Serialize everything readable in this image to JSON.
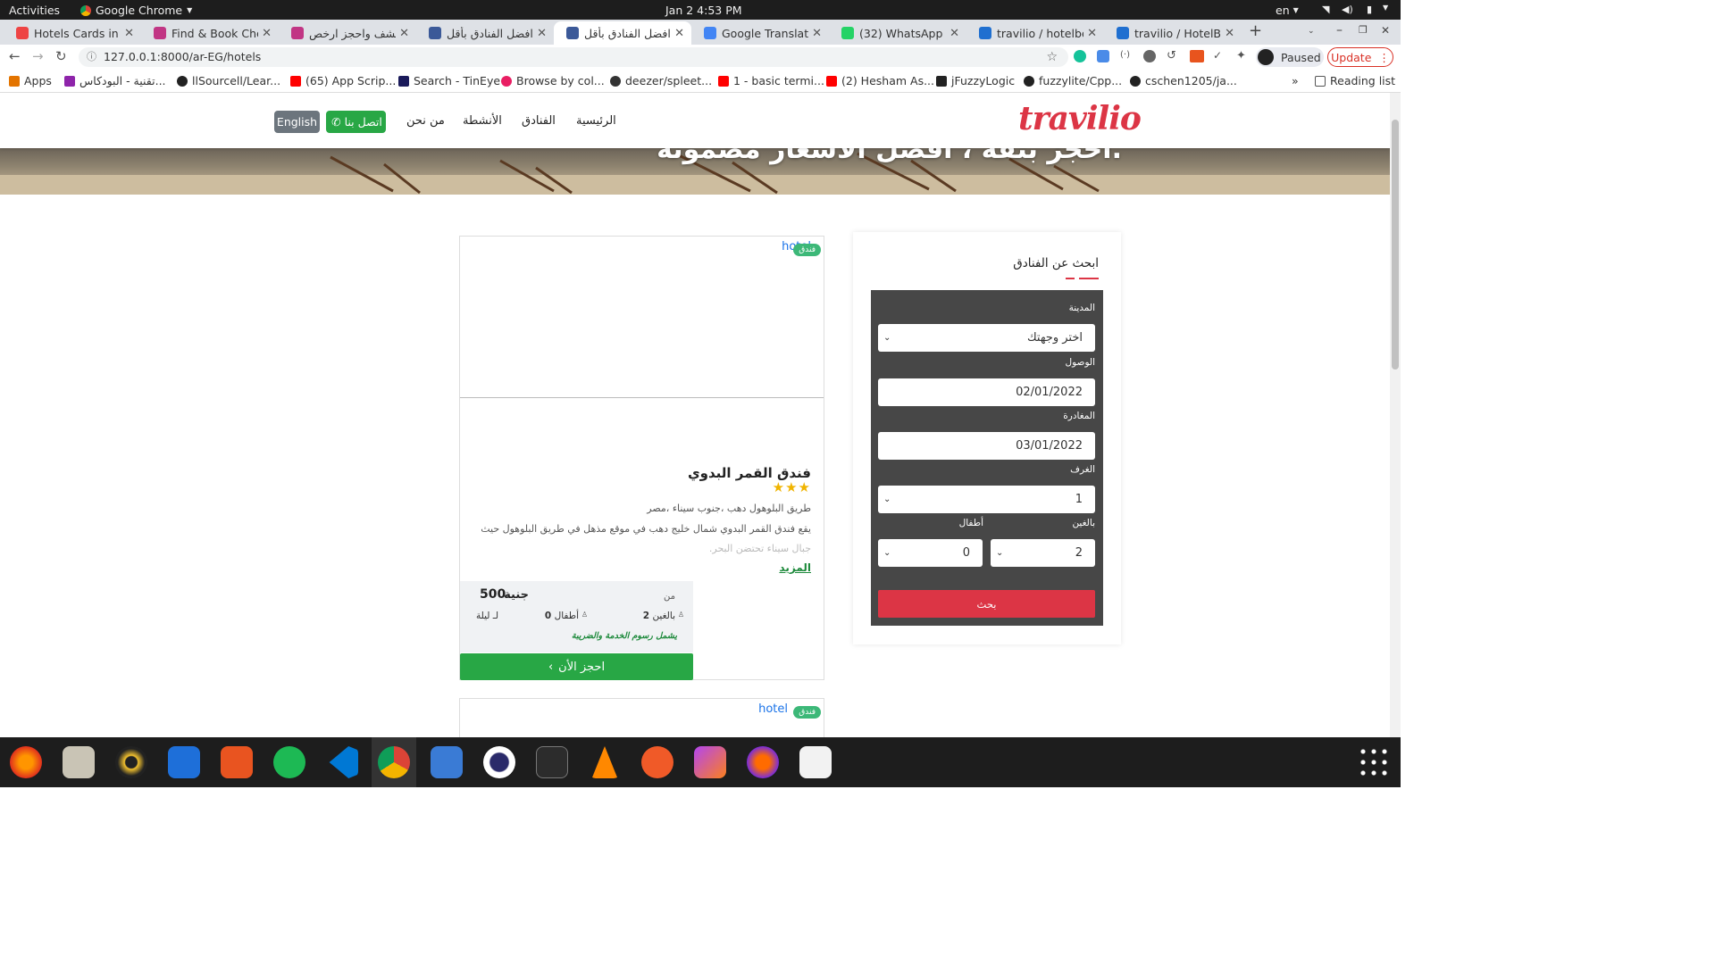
{
  "system": {
    "activities": "Activities",
    "app": "Google Chrome",
    "clock": "Jan 2  4:53 PM",
    "lang": "en"
  },
  "tabs": [
    {
      "title": "Hotels Cards in th",
      "color": "#e44"
    },
    {
      "title": "Find & Book Cheap",
      "color": "#c13584"
    },
    {
      "title": "اكتشف واحجز ارخص",
      "color": "#c13584"
    },
    {
      "title": "افضل الفنادق بأقل",
      "color": "#3b5998"
    },
    {
      "title": "افضل الفنادق بأقل",
      "color": "#3b5998"
    },
    {
      "title": "Google Translate",
      "color": "#4285f4"
    },
    {
      "title": "(32) WhatsApp",
      "color": "#25d366"
    },
    {
      "title": "travilio / hotelbed",
      "color": "#1f6fd0"
    },
    {
      "title": "travilio / HotelBed",
      "color": "#1f6fd0"
    }
  ],
  "browser": {
    "url": "127.0.0.1:8000/ar-EG/hotels",
    "paused": "Paused",
    "update": "Update",
    "reading_list": "Reading list"
  },
  "bookmarks": [
    {
      "label": "Apps",
      "color": "#e37400"
    },
    {
      "label": "تقنية - البودكاس...",
      "color": "#8e24aa"
    },
    {
      "label": "llSourcell/Lear...",
      "color": "#222"
    },
    {
      "label": "(65) App Scrip...",
      "color": "#f00"
    },
    {
      "label": "Search - TinEye",
      "color": "#1a1a5a"
    },
    {
      "label": "Browse by col...",
      "color": "#e91e63"
    },
    {
      "label": "deezer/spleet...",
      "color": "#333"
    },
    {
      "label": "1 - basic termi...",
      "color": "#f00"
    },
    {
      "label": "(2) Hesham As...",
      "color": "#f00"
    },
    {
      "label": "jFuzzyLogic",
      "color": "#222"
    },
    {
      "label": "fuzzylite/Cpp...",
      "color": "#222"
    },
    {
      "label": "cschen1205/ja...",
      "color": "#222"
    }
  ],
  "site": {
    "logo": "travilio",
    "nav": {
      "home": "الرئيسية",
      "hotels": "الفنادق",
      "activities": "الأنشطة",
      "about": "من نحن",
      "contact": "اتصل بنا",
      "english": "English"
    },
    "hero_text": "احجز بثقة ، أفضل الأسعار مضمونة."
  },
  "hotel_card": {
    "image_alt": "hotel",
    "badge": "فندق",
    "name": "فندق القمر البدوي",
    "stars": "★★★",
    "address": "طريق البلوهول دهب ،جنوب سيناء ،مصر",
    "description1": "يقع فندق القمر البدوي شمال خليج دهب في موقع مذهل في طريق البلوهول حيث",
    "description2": "جبال سيناء تحتضن البحر.",
    "more": "المزيد",
    "from": "من",
    "price": "500",
    "currency": "جنية",
    "adults_count": "2",
    "adults_label": "بالغين",
    "children_count": "0",
    "children_label": "أطفال",
    "per_night": "لـ ليلة",
    "tax_note": "يشمل رسوم الخدمة والضريبة",
    "book": "احجز الأن"
  },
  "hotel_card2": {
    "image_alt": "hotel",
    "badge": "فندق"
  },
  "search": {
    "title": "ابحث عن الفنادق",
    "city_label": "المدينة",
    "city_value": "اختر وجهتك",
    "arrival_label": "الوصول",
    "arrival_value": "02/01/2022",
    "departure_label": "المغادرة",
    "departure_value": "03/01/2022",
    "rooms_label": "الغرف",
    "rooms_value": "1",
    "adults_label": "بالغين",
    "adults_value": "2",
    "children_label": "أطفال",
    "children_value": "0",
    "submit": "بحث"
  },
  "colors": {
    "brand_red": "#dc3545",
    "green": "#28a745",
    "dark_box": "#474747"
  }
}
